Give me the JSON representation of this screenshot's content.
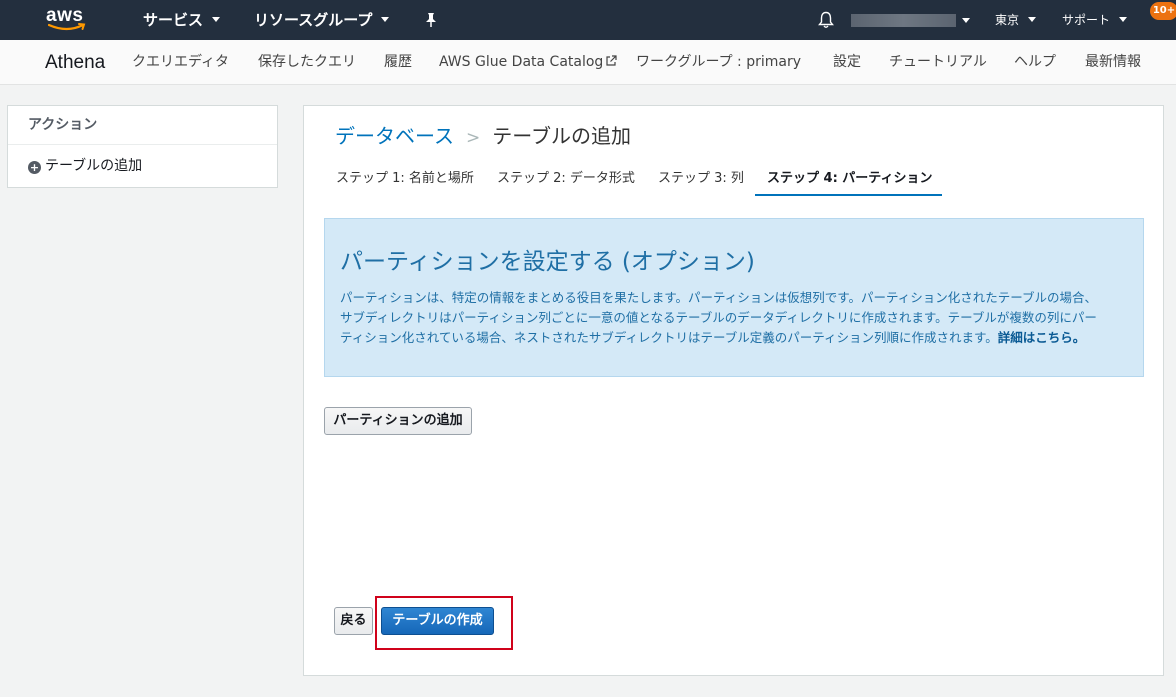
{
  "topbar": {
    "logo": "aws",
    "services": "サービス",
    "resource_groups": "リソースグループ",
    "pin_icon": "pin-icon",
    "bell_icon": "bell-icon",
    "region": "東京",
    "support": "サポート"
  },
  "subnav": {
    "title": "Athena",
    "items": [
      {
        "label": "クエリエディタ"
      },
      {
        "label": "保存したクエリ"
      },
      {
        "label": "履歴"
      },
      {
        "label": "AWS Glue Data Catalog"
      },
      {
        "label": "ワークグループ : primary"
      },
      {
        "label": "設定"
      },
      {
        "label": "チュートリアル"
      },
      {
        "label": "ヘルプ"
      },
      {
        "label": "最新情報"
      }
    ],
    "badge": "10+"
  },
  "left": {
    "heading": "アクション",
    "add_table": "テーブルの追加"
  },
  "main": {
    "breadcrumb_db": "データベース",
    "breadcrumb_sep": ">",
    "breadcrumb_current": "テーブルの追加",
    "steps": [
      {
        "label": "ステップ 1: 名前と場所"
      },
      {
        "label": "ステップ 2: データ形式"
      },
      {
        "label": "ステップ 3: 列"
      },
      {
        "label": "ステップ 4: パーティション"
      }
    ],
    "info_title": "パーティションを設定する (オプション)",
    "info_body": "パーティションは、特定の情報をまとめる役目を果たします。パーティションは仮想列です。パーティション化されたテーブルの場合、サブディレクトリはパーティション列ごとに一意の値となるテーブルのデータディレクトリに作成されます。テーブルが複数の列にパーティション化されている場合、ネストされたサブディレクトリはテーブル定義のパーティション列順に作成されます。",
    "info_link": "詳細はこちら。",
    "add_partition_button": "パーティションの追加",
    "back_button": "戻る",
    "create_button": "テーブルの作成"
  },
  "colors": {
    "nav_bg": "#232f3e",
    "accent": "#0073bb",
    "info_bg": "#d4e9f7",
    "badge": "#ec7211",
    "highlight": "#d0021b"
  }
}
